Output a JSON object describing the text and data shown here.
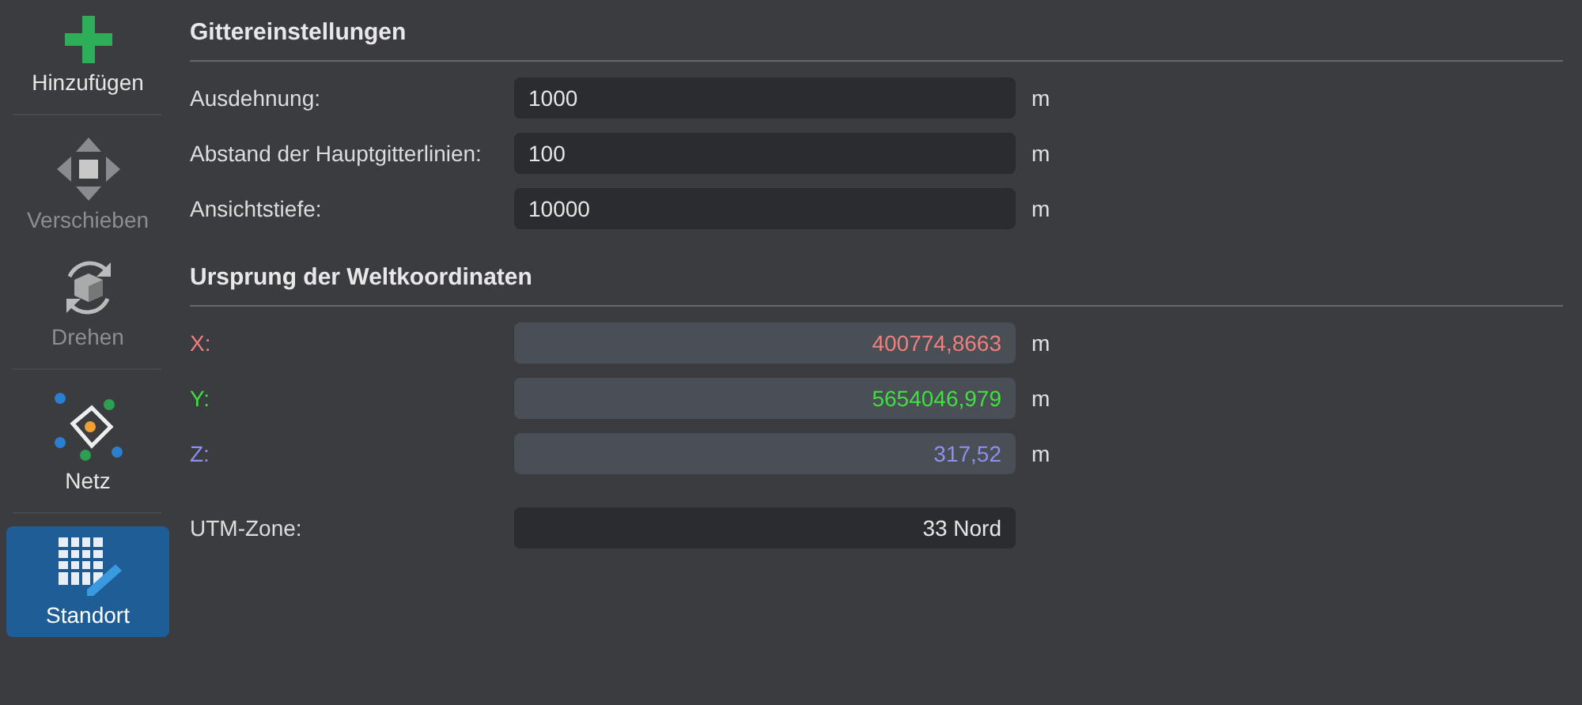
{
  "sidebar": {
    "groups": [
      [
        {
          "label": "Hinzufügen",
          "disabled": false,
          "selected": false
        }
      ],
      [
        {
          "label": "Verschieben",
          "disabled": true,
          "selected": false
        },
        {
          "label": "Drehen",
          "disabled": true,
          "selected": false
        }
      ],
      [
        {
          "label": "Netz",
          "disabled": false,
          "selected": false
        }
      ],
      [
        {
          "label": "Standort",
          "disabled": false,
          "selected": true
        }
      ]
    ]
  },
  "sections": [
    {
      "title": "Gittereinstellungen",
      "rows": [
        {
          "kind": "input",
          "label": "Ausdehnung:",
          "value": "1000",
          "unit": "m"
        },
        {
          "kind": "input",
          "label": "Abstand der Hauptgitterlinien:",
          "value": "100",
          "unit": "m"
        },
        {
          "kind": "input",
          "label": "Ansichtstiefe:",
          "value": "10000",
          "unit": "m"
        }
      ]
    },
    {
      "title": "Ursprung der Weltkoordinaten",
      "rows": [
        {
          "kind": "coordinate",
          "label": "X:",
          "value": "400774,8663",
          "unit": "m",
          "color": "#f07f7f"
        },
        {
          "kind": "coordinate",
          "label": "Y:",
          "value": "5654046,979",
          "unit": "m",
          "color": "#3fe03f"
        },
        {
          "kind": "coordinate",
          "label": "Z:",
          "value": "317,52",
          "unit": "m",
          "color": "#8f8ff0"
        },
        {
          "kind": "zone",
          "label": "UTM-Zone:",
          "value": "33 Nord"
        }
      ]
    }
  ]
}
